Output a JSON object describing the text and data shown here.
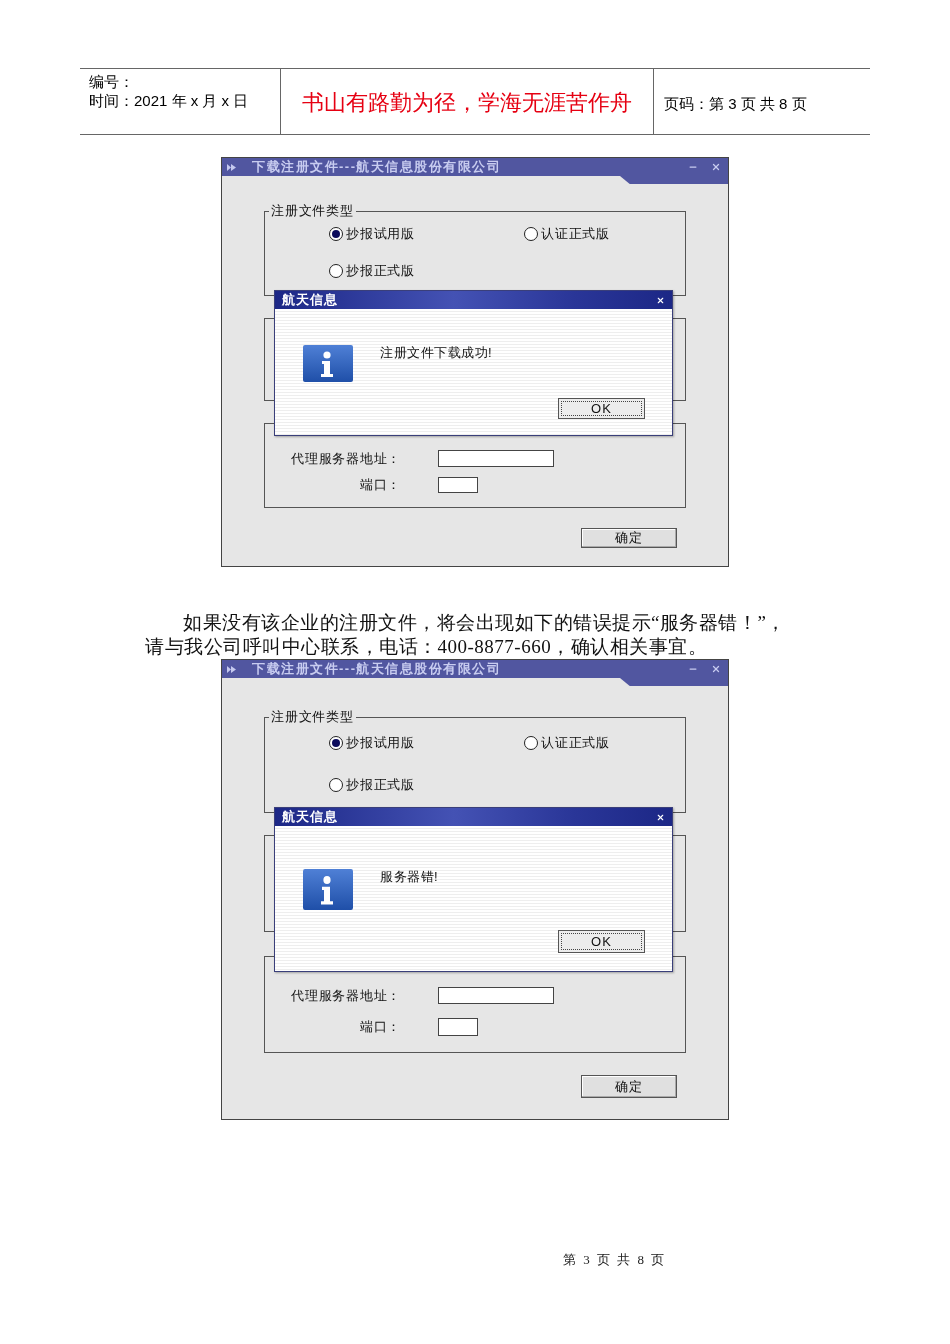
{
  "header": {
    "number_label": "编号：",
    "date": "时间：2021 年 x 月 x 日",
    "motto": "书山有路勤为径，学海无涯苦作舟",
    "page_info": "页码：第 3 页 共 8 页"
  },
  "content": [
    {
      "kind": "screenshot",
      "window": {
        "title": "下载注册文件---航天信息股份有限公司"
      },
      "file_type_group": {
        "label": "注册文件类型",
        "options": [
          {
            "label": "抄报试用版",
            "selected": true
          },
          {
            "label": "认证正式版",
            "selected": false
          },
          {
            "label": "抄报正式版",
            "selected": false
          }
        ]
      },
      "proxy_group": {
        "address_label": "代理服务器地址：",
        "port_label": "端口："
      },
      "confirm_button": "确定",
      "message_box": {
        "title": "航天信息",
        "message": "注册文件下载成功!",
        "button": "OK"
      }
    },
    {
      "kind": "paragraph",
      "text": "如果没有该企业的注册文件，将会出现如下的错误提示“服务器错！”，请与我公司呼叫中心联系，电话：400-8877-660，确认相关事宜。"
    },
    {
      "kind": "screenshot",
      "window": {
        "title": "下载注册文件---航天信息股份有限公司"
      },
      "file_type_group": {
        "label": "注册文件类型",
        "options": [
          {
            "label": "抄报试用版",
            "selected": true
          },
          {
            "label": "认证正式版",
            "selected": false
          },
          {
            "label": "抄报正式版",
            "selected": false
          }
        ]
      },
      "proxy_group": {
        "address_label": "代理服务器地址：",
        "port_label": "端口："
      },
      "confirm_button": "确定",
      "message_box": {
        "title": "航天信息",
        "message": "服务器错!",
        "button": "OK"
      }
    }
  ],
  "footer": {
    "page_number": "第 3 页 共 8 页"
  }
}
